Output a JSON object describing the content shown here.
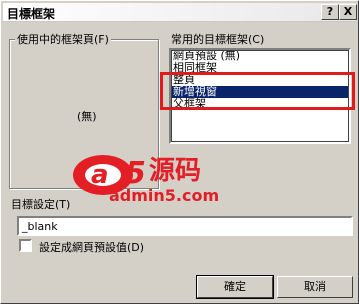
{
  "dialog": {
    "title": "目標框架",
    "help_label": "?",
    "close_label": "X"
  },
  "current_frames": {
    "label": "使用中的框架頁(F)",
    "empty_text": "(無)"
  },
  "common_frames": {
    "label": "常用的目標框架(C)",
    "items": [
      {
        "label": "網頁預設 (無)",
        "selected": false
      },
      {
        "label": "相同框架",
        "selected": false
      },
      {
        "label": "整頁",
        "selected": false
      },
      {
        "label": "新增視窗",
        "selected": true
      },
      {
        "label": "父框架",
        "selected": false
      }
    ]
  },
  "watermark": {
    "logo_glyph": "a5",
    "logo_cn": "源码",
    "site": "admin5.com"
  },
  "target": {
    "label": "目標設定(T)",
    "value": "_blank"
  },
  "default_checkbox": {
    "label": "設定成網頁預設值(D)",
    "checked": false
  },
  "buttons": {
    "ok": "確定",
    "cancel": "取消"
  },
  "colors": {
    "selection": "#0a246a",
    "highlight_box": "#e21a1a",
    "face": "#d4d0c8"
  }
}
